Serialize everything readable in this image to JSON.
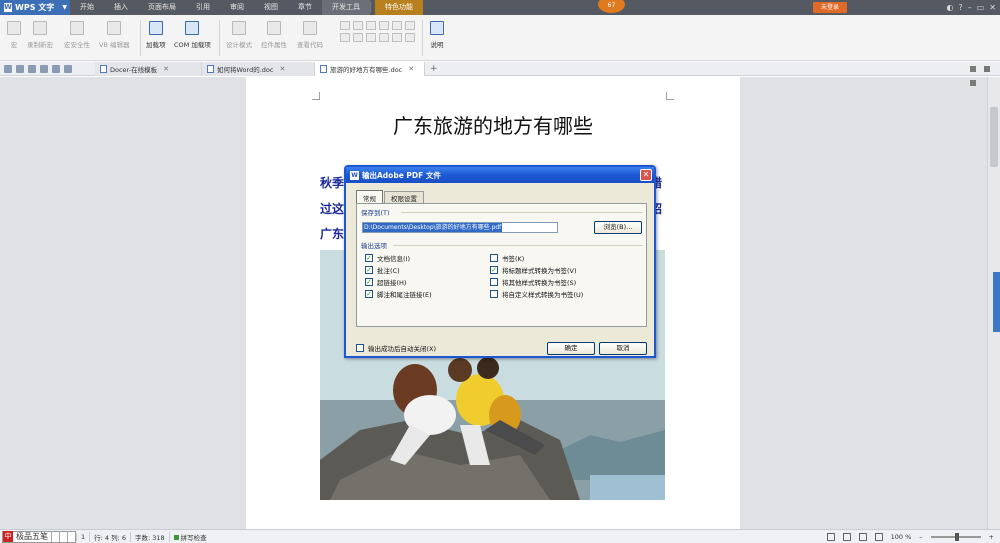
{
  "app": {
    "name": "WPS 文字",
    "menu": [
      "开始",
      "插入",
      "页面布局",
      "引用",
      "审阅",
      "视图",
      "章节",
      "开发工具",
      "特色功能"
    ],
    "active_menu": "开发工具",
    "badge": "67",
    "login_label": "未登录"
  },
  "ribbon": {
    "buttons": [
      "宏",
      "录制新宏",
      "宏安全性",
      "VB 编辑器",
      "加载项",
      "COM 加载项",
      "设计模式",
      "控件属性",
      "查看代码",
      "说明"
    ]
  },
  "tabs": [
    {
      "label": "Docer-在线模板"
    },
    {
      "label": "如何将Word的.doc"
    },
    {
      "label": "旅游的好地方有哪些.doc"
    }
  ],
  "document": {
    "title": "广东旅游的地方有哪些",
    "line1_start": "秋季",
    "line1_end": "错",
    "line2_start": "过这",
    "line2_end": "绍",
    "line3_start": "广东"
  },
  "dialog": {
    "title": "输出Adobe PDF 文件",
    "close_glyph": "✕",
    "tabs": [
      "常规",
      "权限设置"
    ],
    "save_group_label": "保存到(T)",
    "save_path": "D:\\Documents\\Desktop\\旅游的好地方有哪些.pdf",
    "browse_label": "浏览(B)...",
    "options_group_label": "输出选项",
    "options_left": [
      {
        "label": "文档信息(I)",
        "checked": true
      },
      {
        "label": "批注(C)",
        "checked": true
      },
      {
        "label": "超链接(H)",
        "checked": true
      },
      {
        "label": "脚注和尾注链接(E)",
        "checked": true
      }
    ],
    "options_right": [
      {
        "label": "书签(K)",
        "checked": false
      },
      {
        "label": "将标题样式转换为书签(V)",
        "checked": true
      },
      {
        "label": "将其他样式转换为书签(S)",
        "checked": false
      },
      {
        "label": "将自定义样式转换为书签(U)",
        "checked": false
      }
    ],
    "auto_close_label": "输出成功后自动关闭(X)",
    "ok_label": "确定",
    "cancel_label": "取消"
  },
  "status": {
    "ime_label": "极品五笔",
    "page": "1",
    "row_col": "行: 4  列: 6",
    "word_count": "字数: 318",
    "spell_check": "拼写检查",
    "zoom": "100 %"
  },
  "colors": {
    "accent": "#3d6fb6",
    "doc_text": "#1a2a9a",
    "dialog_title": "#1d58d4"
  }
}
